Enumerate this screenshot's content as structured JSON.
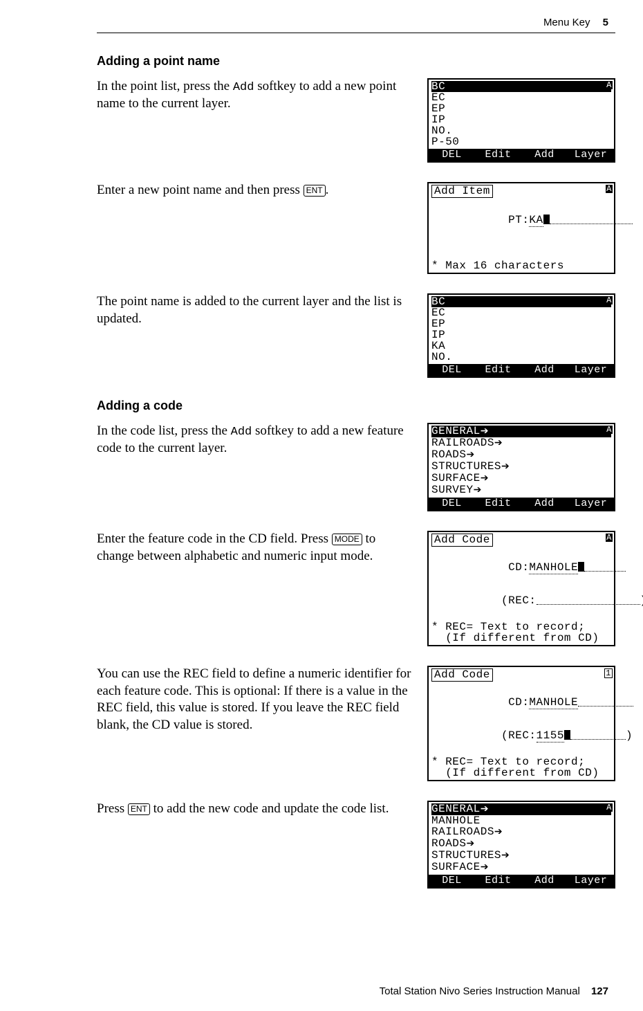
{
  "header": {
    "title": "Menu Key",
    "chapter": "5"
  },
  "footer": {
    "title": "Total Station Nivo Series Instruction Manual",
    "page": "127"
  },
  "sec1": {
    "heading": "Adding a point name",
    "step1": {
      "t1": "In the point list, press the ",
      "soft": "Add",
      "t2": " softkey to add a new point name to the current layer."
    },
    "step2": {
      "t1": "Enter a new point name and then press ",
      "key": "ENT",
      "t2": "."
    },
    "step3": {
      "t1": "The point name is added to the current layer and the list is updated."
    }
  },
  "sec2": {
    "heading": "Adding a code",
    "step1": {
      "t1": "In the code list, press the ",
      "soft": "Add",
      "t2": " softkey to add a new feature code to the current layer."
    },
    "step2": {
      "t1": "Enter the feature code in the CD field. Press ",
      "key": "MODE",
      "t2": " to change between alphabetic and numeric input mode."
    },
    "step3": {
      "t1": "You can use the REC field to define a numeric identifier for each feature code. This is optional: If there is a value in the REC field, this value is stored. If you leave the REC field blank, the CD value is stored."
    },
    "step4": {
      "t1": "Press ",
      "key": "ENT",
      "t2": " to add the new code and update the code list."
    }
  },
  "lcd": {
    "softkeys": {
      "del": "DEL",
      "edit": "Edit",
      "add": "Add",
      "layer": "Layer"
    },
    "screen1": {
      "l1": "BC",
      "l2": "EC",
      "l3": "EP",
      "l4": "IP",
      "l5": "NO.",
      "l6": "P-50",
      "flagA": "A"
    },
    "screen2": {
      "title": "Add Item",
      "pt_label": " PT:",
      "pt_val": "KA",
      "hint": "* Max 16 characters",
      "flagA": "A"
    },
    "screen3": {
      "l1": "BC",
      "l2": "EC",
      "l3": "EP",
      "l4": "IP",
      "l5": "KA",
      "l6": "NO.",
      "flagA": "A"
    },
    "screen4": {
      "l1": "GENERAL",
      "l2": "RAILROADS",
      "l3": "ROADS",
      "l4": "STRUCTURES",
      "l5": "SURFACE",
      "l6": "SURVEY",
      "flagA": "A"
    },
    "screen5": {
      "title": "Add Code",
      "cd_label": " CD:",
      "cd_val": "MANHOLE",
      "rec_label": "(REC:",
      "rec_val": "",
      "hint1": "* REC= Text to record;",
      "hint2": "  (If different from CD)",
      "flagA": "A"
    },
    "screen6": {
      "title": "Add Code",
      "cd_label": " CD:",
      "cd_val": "MANHOLE",
      "rec_label": "(REC:",
      "rec_val": "1155",
      "hint1": "* REC= Text to record;",
      "hint2": "  (If different from CD)",
      "flag1": "1"
    },
    "screen7": {
      "l1": "GENERAL",
      "l2": "MANHOLE",
      "l3": "RAILROADS",
      "l4": "ROADS",
      "l5": "STRUCTURES",
      "l6": "SURFACE",
      "flagA": "A"
    }
  }
}
